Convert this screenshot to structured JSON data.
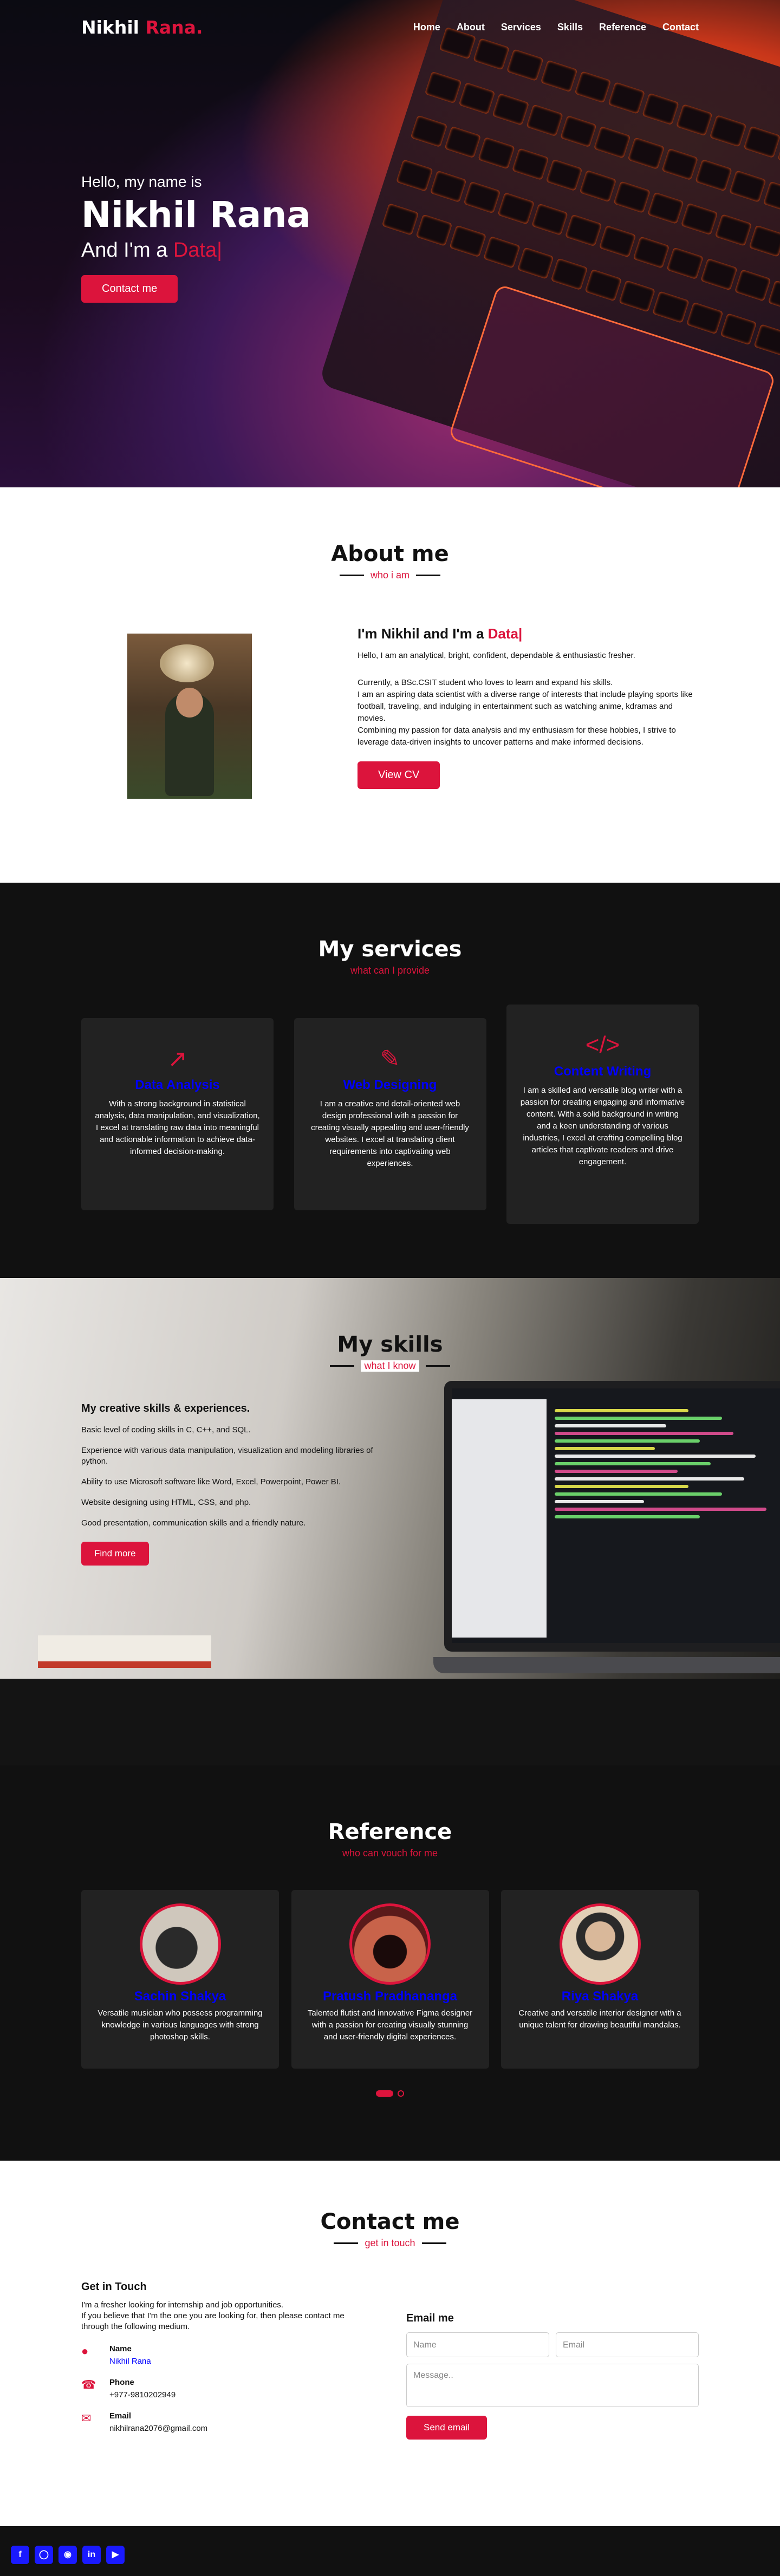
{
  "nav": {
    "logo_main": "Nikhil",
    "logo_accent": "Rana.",
    "items": [
      "Home",
      "About",
      "Services",
      "Skills",
      "Reference",
      "Contact"
    ]
  },
  "hero": {
    "hello": "Hello, my name is",
    "name": "Nikhil Rana",
    "role_prefix": "And I'm a",
    "role_typed": "Data|",
    "button": "Contact me"
  },
  "about": {
    "title": "About me",
    "subtitle": "who i am",
    "heading_prefix": "I'm Nikhil and I'm a",
    "heading_typed": "Data|",
    "intro": "Hello, I am an analytical, bright, confident, dependable & enthusiastic fresher.",
    "para1": "Currently, a BSc.CSIT student who loves to learn and expand his skills.",
    "para2": "I am an aspiring data scientist with a diverse range of interests that include playing sports like football, traveling, and indulging in entertainment such as watching anime, kdramas and movies.",
    "para3": "Combining my passion for data analysis and my enthusiasm for these hobbies, I strive to leverage data-driven insights to uncover patterns and make informed decisions.",
    "button": "View CV"
  },
  "services": {
    "title": "My services",
    "subtitle": "what can I provide",
    "cards": [
      {
        "icon": "chart-line-icon",
        "glyph": "↗",
        "title": "Data Analysis",
        "desc": "With a strong background in statistical analysis, data manipulation, and visualization, I excel at translating raw data into meaningful and actionable information to achieve data-informed decision-making."
      },
      {
        "icon": "paint-brush-icon",
        "glyph": "✎",
        "title": "Web Designing",
        "desc": "I am a creative and detail-oriented web design professional with a passion for creating visually appealing and user-friendly websites. I excel at translating client requirements into captivating web experiences."
      },
      {
        "icon": "code-icon",
        "glyph": "</>",
        "title": "Content Writing",
        "desc": "I am a skilled and versatile blog writer with a passion for creating engaging and informative content. With a solid background in writing and a keen understanding of various industries, I excel at crafting compelling blog articles that captivate readers and drive engagement."
      }
    ]
  },
  "skills": {
    "title": "My skills",
    "subtitle": "what I know",
    "heading": "My creative skills & experiences.",
    "items": [
      "Basic level of coding skills in C, C++, and SQL.",
      "Experience with various data manipulation, visualization and modeling libraries of python.",
      "Ability to use Microsoft software like Word, Excel, Powerpoint, Power BI.",
      "Website designing using HTML, CSS, and php.",
      "Good presentation, communication skills and a friendly nature."
    ],
    "button": "Find more"
  },
  "reference": {
    "title": "Reference",
    "subtitle": "who can vouch for me",
    "cards": [
      {
        "name": "Sachin Shakya",
        "desc": "Versatile musician who possess programming knowledge in various languages with strong photoshop skills."
      },
      {
        "name": "Pratush Pradhananga",
        "desc": "Talented flutist and innovative Figma designer with a passion for creating visually stunning and user-friendly digital experiences."
      },
      {
        "name": "Riya Shakya",
        "desc": "Creative and versatile interior designer with a unique talent for drawing beautiful mandalas."
      }
    ]
  },
  "contact": {
    "title": "Contact me",
    "subtitle": "get in touch",
    "heading": "Get in Touch",
    "intro1": "I'm a fresher looking for internship and job opportunities.",
    "intro2": "If you believe that I'm the one you are looking for, then please contact me through the following medium.",
    "name_label": "Name",
    "name_value": "Nikhil Rana",
    "phone_label": "Phone",
    "phone_value": "+977-9810202949",
    "email_label": "Email",
    "email_value": "nikhilrana2076@gmail.com",
    "form_title": "Email me",
    "placeholder_name": "Name",
    "placeholder_email": "Email",
    "placeholder_message": "Message..",
    "send_button": "Send email"
  },
  "footer": {
    "socials": [
      "facebook-icon",
      "instagram-icon",
      "github-icon",
      "linkedin-icon",
      "youtube-icon"
    ]
  },
  "colors": {
    "accent": "#dc143c",
    "link": "#0000ff",
    "dark": "#111111"
  }
}
